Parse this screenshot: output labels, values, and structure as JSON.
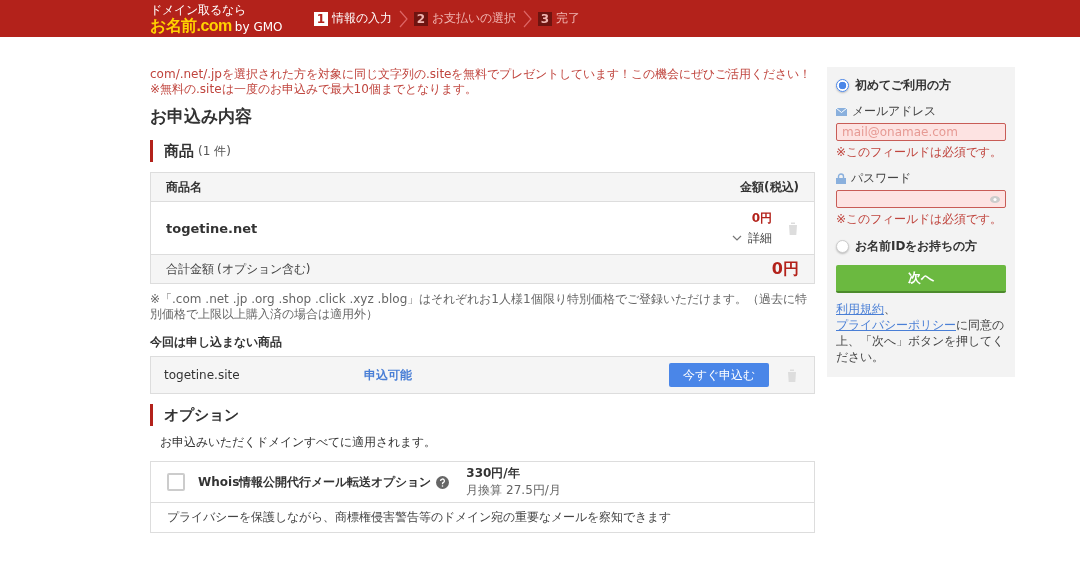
{
  "header": {
    "logo_tagline": "ドメイン取るなら",
    "logo": "お名前.com",
    "logo_sub": "by GMO",
    "steps": [
      {
        "number": "1",
        "label": "情報の入力",
        "selected": true
      },
      {
        "number": "2",
        "label": "お支払いの選択",
        "selected": false
      },
      {
        "number": "3",
        "label": "完了",
        "selected": false
      }
    ]
  },
  "notice": [
    "com/.net/.jpを選択された方を対象に同じ文字列の.siteを無料でプレゼントしています！この機会にぜひご活用ください！",
    "※無料の.siteは一度のお申込みで最大10個までとなります。"
  ],
  "page_title": "お申込み内容",
  "products": {
    "heading": "商品",
    "count": "(1 件)",
    "columns": [
      "商品名",
      "金額(税込)"
    ],
    "rows": [
      {
        "name": "togetine.net",
        "price": "0円",
        "details": "詳細",
        "expanded": false
      }
    ],
    "total_label": "合計金額",
    "total_note": "(オプション含む)",
    "total": "0円",
    "footnote": "※「.com .net .jp .org .shop .click .xyz .blog」はそれぞれお1人様1個限り特別価格でご登録いただけます。（過去に特別価格で上限以上購入済の場合は適用外）"
  },
  "not_applied": {
    "heading": "今回は申し込まない商品",
    "rows": [
      {
        "name": "togetine.site",
        "status": "申込可能",
        "button": "今すぐ申込む"
      }
    ]
  },
  "options": {
    "heading": "オプション",
    "description": "お申込みいただくドメインすべてに適用されます。",
    "items": [
      {
        "name": "Whois情報公開代行メール転送オプション",
        "price": "330円/年",
        "monthly": "月換算 27.5円/月",
        "checked": false,
        "description": "プライバシーを保護しながら、商標権侵害警告等のドメイン宛の重要なメールを察知できます"
      }
    ]
  },
  "login": {
    "choices": [
      {
        "label": "初めてご利用の方",
        "selected": true
      },
      {
        "label": "お名前IDをお持ちの方",
        "selected": false
      }
    ],
    "email_label": "メールアドレス",
    "email_placeholder": "mail@onamae.com",
    "email_error": "※このフィールドは必須です。",
    "password_label": "パスワード",
    "password_error": "※このフィールドは必須です。",
    "next_button": "次へ",
    "terms_link": "利用規約",
    "separator": "、",
    "privacy_link": "プライバシーポリシー",
    "terms_text": "に同意の上、「次へ」ボタンを押してください。"
  }
}
